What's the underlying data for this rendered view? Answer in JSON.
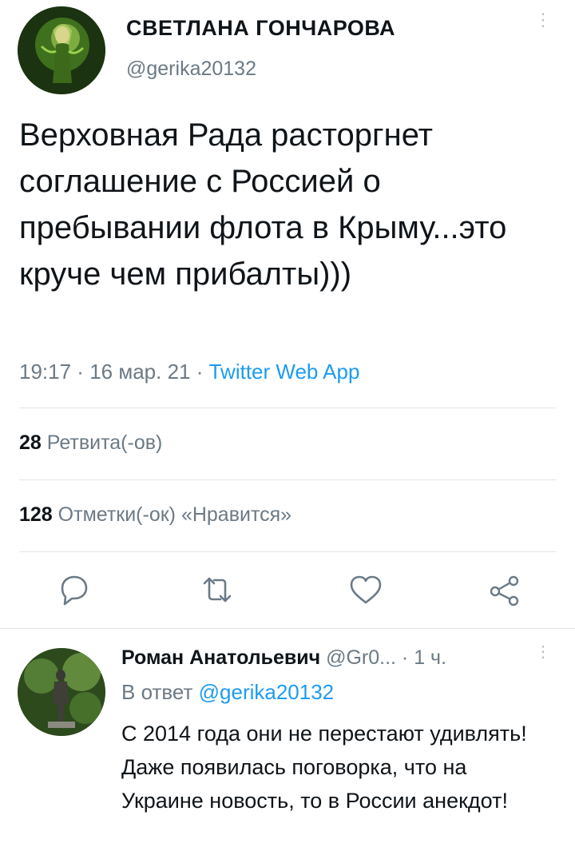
{
  "tweet": {
    "author_name": "СВЕТЛАНА ГОНЧАРОВА",
    "author_handle": "@gerika20132",
    "text": "Верховная Рада расторгнет соглашение с Россией о пребывании флота в Крыму...это круче чем прибалты)))",
    "time": "19:17",
    "date": "16 мар. 21",
    "source": "Twitter Web App",
    "meta_sep": " · ",
    "retweets_count": "28",
    "retweets_label": "Ретвита(-ов)",
    "likes_count": "128",
    "likes_label": "Отметки(-ок) «Нравится»",
    "more_icon": "⋮"
  },
  "actions": {
    "reply_icon": "reply-icon",
    "retweet_icon": "retweet-icon",
    "like_icon": "like-icon",
    "share_icon": "share-icon",
    "icon_color": "#6b7a86"
  },
  "reply": {
    "author_name": "Роман Анатольевич",
    "author_handle": "@Gr0...",
    "time": "1 ч.",
    "time_sep": " · ",
    "reply_to_label": "В ответ",
    "reply_to_handle": "@gerika20132",
    "text": "С 2014 года они не перестают удивлять! Даже появилась поговорка, что на Украине новость, то в России анекдот!",
    "more_icon": "⋮"
  },
  "colors": {
    "accent": "#1d9bf0",
    "secondary_text": "#6b7a86",
    "divider": "#e1e6ea"
  }
}
